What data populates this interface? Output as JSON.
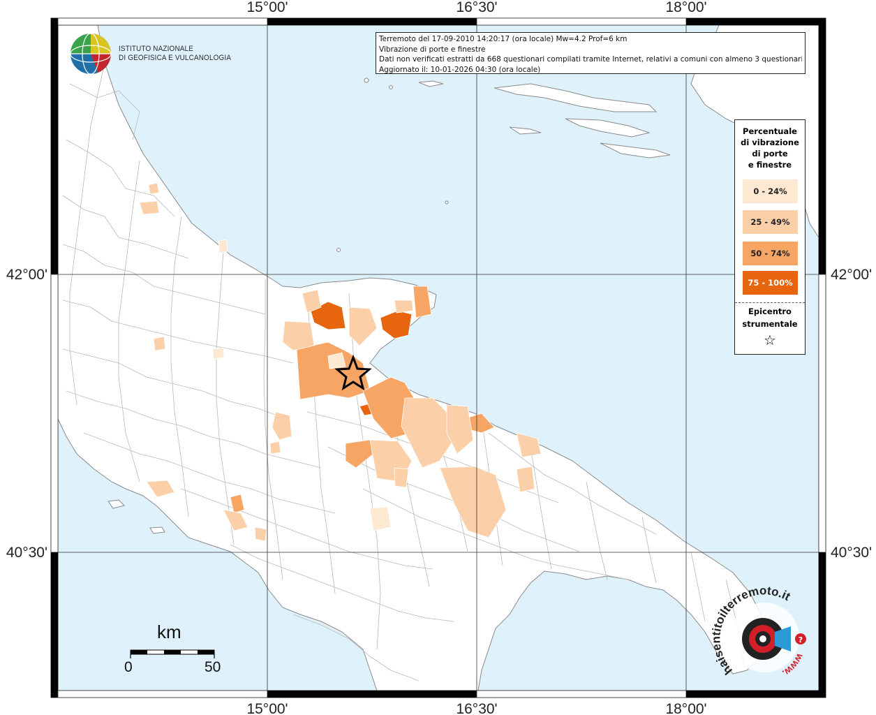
{
  "info": {
    "line1": "Terremoto del 17-09-2010 14:20:17 (ora locale) Mw=4.2 Prof=6 km",
    "line2": "Vibrazione di porte e finestre",
    "line3": "Dati non verificati estratti da 668 questionari compilati tramite Internet, relativi a comuni con almeno 3 questionari.",
    "line4": "Aggiornato il: 10-01-2026 04:30 (ora locale)"
  },
  "axes": {
    "lon_labels": [
      "15°00'",
      "16°30'",
      "18°00'"
    ],
    "lat_labels": [
      "42°00'",
      "40°30'"
    ]
  },
  "logo": {
    "line1": "ISTITUTO NAZIONALE",
    "line2": "DI GEOFISICA E VULCANOLOGIA"
  },
  "legend": {
    "title_lines": [
      "Percentuale",
      "di vibrazione",
      "di porte",
      "e finestre"
    ],
    "classes": [
      {
        "label": "0 - 24%",
        "color": "#fde8d2"
      },
      {
        "label": "25 - 49%",
        "color": "#fbcfa8"
      },
      {
        "label": "50 - 74%",
        "color": "#f6a564"
      },
      {
        "label": "75 - 100%",
        "color": "#e8650f"
      }
    ],
    "epicenter_lines": [
      "Epicentro",
      "strumentale"
    ],
    "epicenter_symbol": "☆"
  },
  "scale": {
    "unit": "km",
    "min": "0",
    "max": "50"
  },
  "badge": {
    "text_top": "haisentitoilterremoto.it",
    "text_bottom": "www."
  },
  "colors": {
    "sea": "#dff1fb",
    "land": "#ffffff",
    "border": "#9a9a9a"
  }
}
